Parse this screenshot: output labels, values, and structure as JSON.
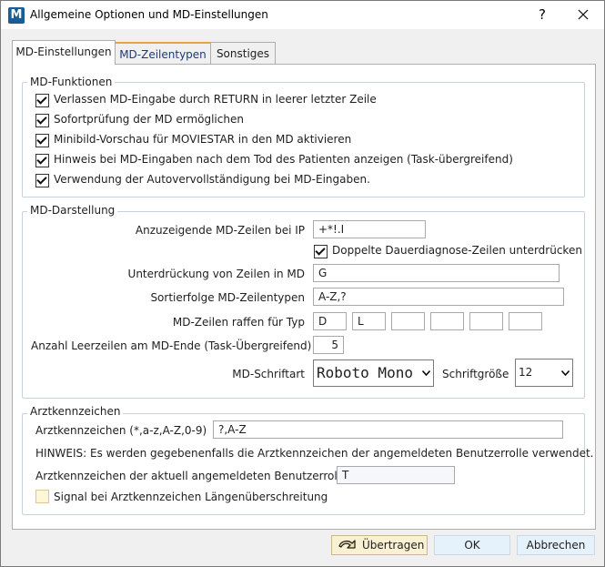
{
  "window": {
    "title": "Allgemeine Optionen und MD-Einstellungen",
    "help": "?",
    "close": "✕"
  },
  "tabs": [
    {
      "label": "MD-Einstellungen"
    },
    {
      "label": "MD-Zeilentypen"
    },
    {
      "label": "Sonstiges"
    }
  ],
  "md_funktionen": {
    "legend": "MD-Funktionen",
    "items": [
      {
        "label": "Verlassen MD-Eingabe durch RETURN in leerer letzter Zeile",
        "checked": true
      },
      {
        "label": "Sofortprüfung der MD ermöglichen",
        "checked": true
      },
      {
        "label": "Minibild-Vorschau für MOVIESTAR in den MD aktivieren",
        "checked": true
      },
      {
        "label": "Hinweis bei MD-Eingaben nach dem Tod des Patienten anzeigen (Task-übergreifend)",
        "checked": true
      },
      {
        "label": "Verwendung der Autovervollständigung bei MD-Eingaben.",
        "checked": true
      }
    ]
  },
  "md_darstellung": {
    "legend": "MD-Darstellung",
    "zeilen_label": "Anzuzeigende MD-Zeilen bei IP",
    "zeilen_value": "+*!.I",
    "dauerdiagnose_label": "Doppelte Dauerdiagnose-Zeilen unterdrücken",
    "dauerdiagnose_checked": true,
    "unterdrueckung_label": "Unterdrückung von Zeilen in MD",
    "unterdrueckung_value": "G",
    "sortierfolge_label": "Sortierfolge MD-Zeilentypen",
    "sortierfolge_value": "A-Z,?",
    "raffen_label": "MD-Zeilen raffen für Typ",
    "raffen_values": [
      "D",
      "L",
      "",
      "",
      "",
      ""
    ],
    "leerzeilen_label": "Anzahl Leerzeilen am MD-Ende (Task-Übergreifend)",
    "leerzeilen_value": "5",
    "schriftart_label": "MD-Schriftart",
    "schriftart_value": "Roboto Mono",
    "schriftgroesse_label": "Schriftgröße",
    "schriftgroesse_value": "12"
  },
  "arztkennzeichen": {
    "legend": "Arztkennzeichen",
    "ak_label": "Arztkennzeichen (*,a-z,A-Z,0-9)",
    "ak_value": "?,A-Z",
    "hinweis": "HINWEIS: Es werden gegebenenfalls die Arztkennzeichen der angemeldeten Benutzerrolle verwendet.",
    "aktuell_label": "Arztkennzeichen der aktuell angemeldeten Benutzerrolle",
    "aktuell_value": "T",
    "signal_label": "Signal bei Arztkennzeichen Längenüberschreitung",
    "signal_checked": false
  },
  "buttons": {
    "uebertragen": "Übertragen",
    "ok": "OK",
    "abbrechen": "Abbrechen"
  },
  "icons": {
    "app": "app-logo-icon",
    "uebertragen": "apply-arrow-icon"
  },
  "colors": {
    "app_icon": "#1a5c95",
    "default_button": "#faf1d2",
    "group_border": "#c6d2e0"
  }
}
